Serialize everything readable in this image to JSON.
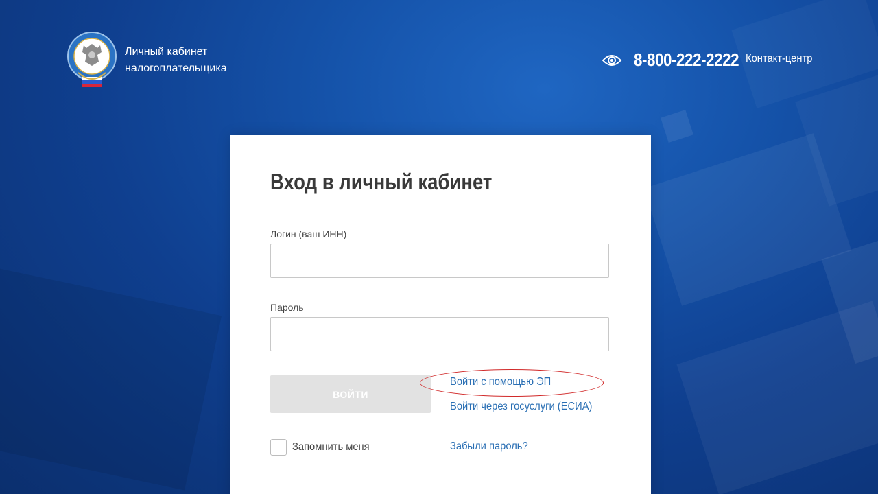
{
  "header": {
    "brand_line1": "Личный кабинет",
    "brand_line2": "налогоплательщика",
    "phone": "8-800-222-2222",
    "contact_label": "Контакт-центр",
    "accessibility_icon": "eye-icon"
  },
  "login_form": {
    "title": "Вход в личный кабинет",
    "login_label": "Логин (ваш ИНН)",
    "login_value": "",
    "password_label": "Пароль",
    "password_value": "",
    "submit_label": "ВОЙТИ",
    "ep_link": "Войти с помощью ЭП",
    "esia_link": "Войти через госуслуги (ЕСИА)",
    "remember_label": "Запомнить меня",
    "remember_checked": false,
    "forgot_link": "Забыли пароль?"
  },
  "colors": {
    "background_blue": "#1553aa",
    "link_blue": "#2a6fb4",
    "disabled_button": "#e2e2e2",
    "highlight_red": "#d12a2a"
  }
}
